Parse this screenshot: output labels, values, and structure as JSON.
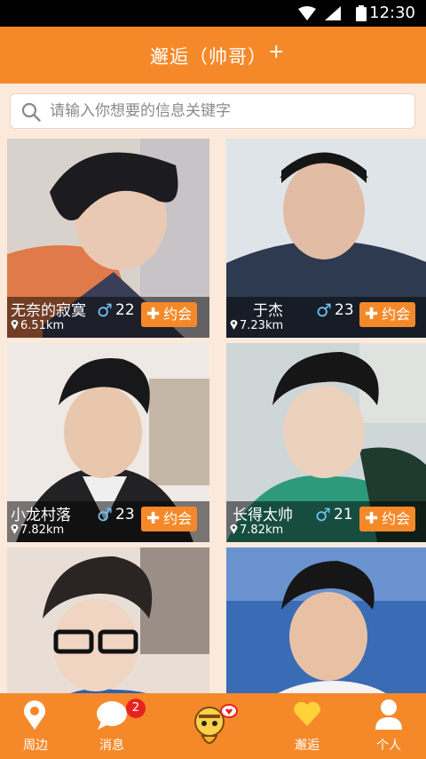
{
  "status_bar": {
    "time": "12:30"
  },
  "header": {
    "title": "邂逅（帅哥）",
    "add_label": "+"
  },
  "search": {
    "placeholder": "请输入你想要的信息关键字"
  },
  "cards": [
    {
      "name": "无奈的寂寞",
      "age": "22",
      "distance": "6.51km",
      "action": "约会"
    },
    {
      "name": "于杰",
      "age": "23",
      "distance": "7.23km",
      "action": "约会"
    },
    {
      "name": "小龙村落",
      "age": "23",
      "distance": "7.82km",
      "action": "约会"
    },
    {
      "name": "长得太帅",
      "age": "21",
      "distance": "7.82km",
      "action": "约会"
    },
    {
      "name": "",
      "age": "",
      "distance": "",
      "action": ""
    },
    {
      "name": "",
      "age": "",
      "distance": "",
      "action": ""
    }
  ],
  "tabs": [
    {
      "label": "周边",
      "icon": "location-pin-icon"
    },
    {
      "label": "消息",
      "icon": "chat-bubble-icon",
      "badge": "2"
    },
    {
      "label": "",
      "icon": "bee-mascot-icon"
    },
    {
      "label": "邂逅",
      "icon": "heart-icon"
    },
    {
      "label": "个人",
      "icon": "person-icon"
    }
  ],
  "colors": {
    "accent": "#f5892a",
    "background": "#fbe9dc",
    "male": "#6ec3f7",
    "badge": "#e8231f"
  }
}
